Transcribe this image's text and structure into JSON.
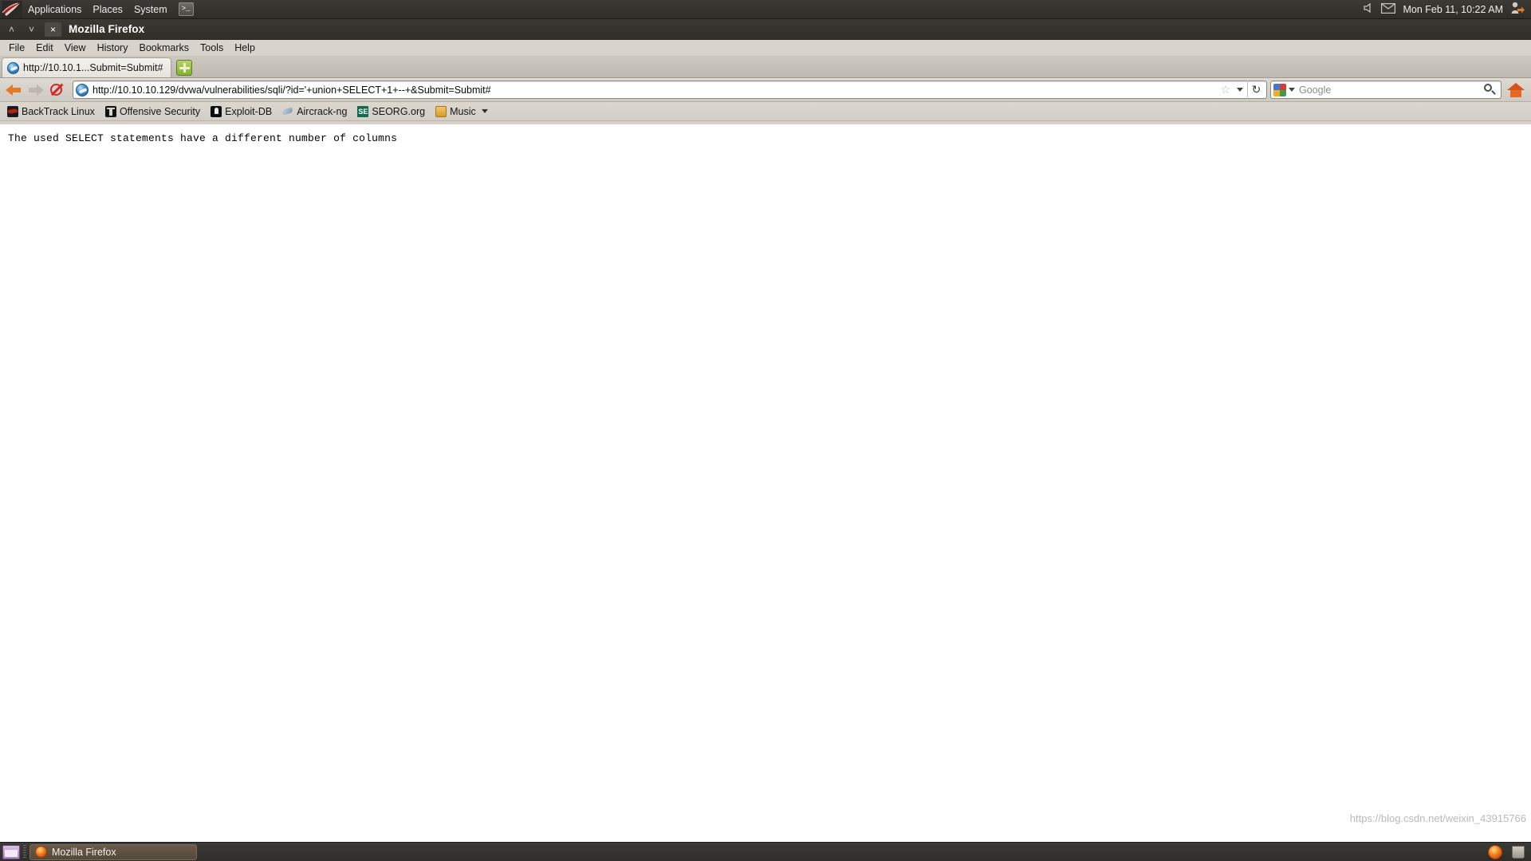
{
  "panel": {
    "logo_icon": "backtrack-dragon-logo",
    "menus": [
      {
        "label": "Applications"
      },
      {
        "label": "Places"
      },
      {
        "label": "System"
      }
    ],
    "terminal_launcher_glyph": ">_",
    "volume_icon": "volume-icon",
    "mail_icon": "mail-icon",
    "clock": "Mon Feb 11, 10:22 AM",
    "user_icon": "user-logout-icon"
  },
  "window": {
    "title": "Mozilla Firefox",
    "minimize_glyph": "˄",
    "maximize_glyph": "˅",
    "close_glyph": "×"
  },
  "menubar": [
    {
      "label": "File",
      "accel": "F"
    },
    {
      "label": "Edit",
      "accel": "E"
    },
    {
      "label": "View",
      "accel": "V"
    },
    {
      "label": "History",
      "accel": "s"
    },
    {
      "label": "Bookmarks",
      "accel": "B"
    },
    {
      "label": "Tools",
      "accel": "T"
    },
    {
      "label": "Help",
      "accel": "H"
    }
  ],
  "tabs": {
    "active_title": "http://10.10.1...Submit=Submit#",
    "favicon": "globe-favicon",
    "new_tab_label": "+"
  },
  "navbar": {
    "back_icon": "back-arrow-icon",
    "forward_icon": "forward-arrow-icon",
    "stop_icon": "stop-icon",
    "url_favicon": "globe-favicon",
    "url_value": "http://10.10.10.129/dvwa/vulnerabilities/sqli/?id='+union+SELECT+1+--+&Submit=Submit#",
    "star_glyph": "☆",
    "reload_glyph": "↻",
    "search_engine": "Google",
    "search_placeholder": "Google",
    "search_icon": "magnifier-icon",
    "home_icon": "home-icon"
  },
  "bookmarks": [
    {
      "label": "BackTrack Linux",
      "icon": "backtrack-icon",
      "has_menu": false
    },
    {
      "label": "Offensive Security",
      "icon": "offensive-security-icon",
      "has_menu": false
    },
    {
      "label": "Exploit-DB",
      "icon": "exploit-db-icon",
      "has_menu": false
    },
    {
      "label": "Aircrack-ng",
      "icon": "aircrack-ng-icon",
      "has_menu": false
    },
    {
      "label": "SEORG.org",
      "icon": "seorg-icon",
      "icon_text": "SE",
      "has_menu": false
    },
    {
      "label": "Music",
      "icon": "music-folder-icon",
      "has_menu": true
    }
  ],
  "page": {
    "body_text": "The used SELECT statements have a different number of columns"
  },
  "statusbar": {
    "watermark": "https://blog.csdn.net/weixin_43915766"
  },
  "taskbar": {
    "show_desktop_icon": "show-desktop-icon",
    "window_button_label": "Mozilla Firefox",
    "window_button_icon": "firefox-icon",
    "tray_firefox_icon": "firefox-icon",
    "tray_trash_icon": "trash-icon"
  },
  "colors": {
    "panel_bg": "#35342f",
    "chrome_bg": "#d6d2ca",
    "accent_orange": "#e07b28",
    "taskbar_active": "#5d4f42"
  }
}
